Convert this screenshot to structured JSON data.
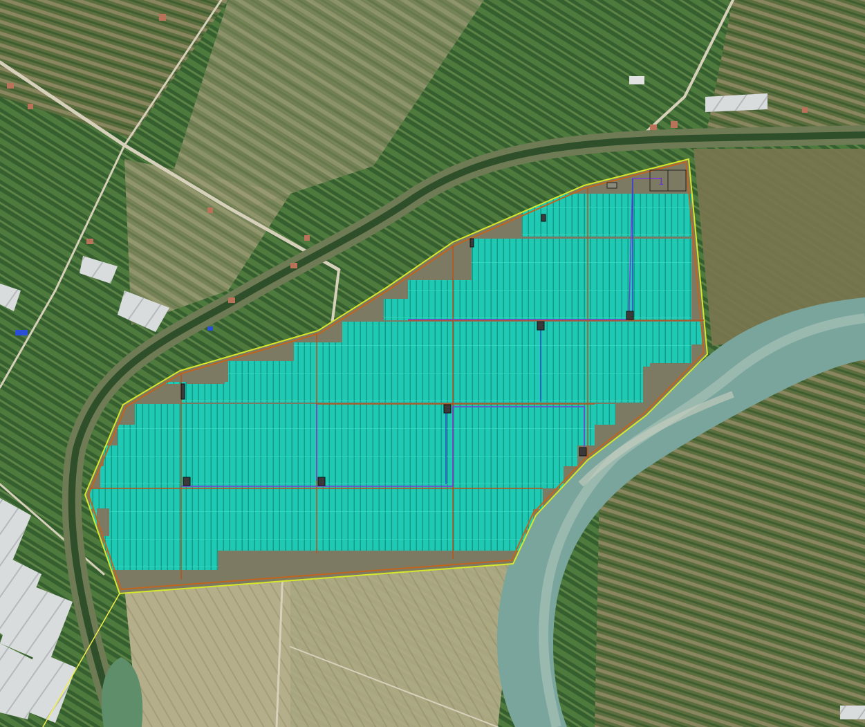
{
  "map": {
    "type": "satellite-solar-layout",
    "labels": [
      {
        "id": "inverter-station-label",
        "text": "1"
      }
    ],
    "colors": {
      "panel": "#1fc9b3",
      "panel_dark": "#17a894",
      "boundary_outer": "#d6e82a",
      "boundary_inner": "#c0641e",
      "cable_purple": "#7a3bd6",
      "cable_blue": "#3044c8",
      "river": "#7aa59d",
      "farmland_dark": "#2f5a2c",
      "farmland_light": "#a8a47c",
      "road": "#d9d2bd",
      "greenhouse": "#e6e8ea",
      "connection_line": "#f5f04a"
    }
  }
}
